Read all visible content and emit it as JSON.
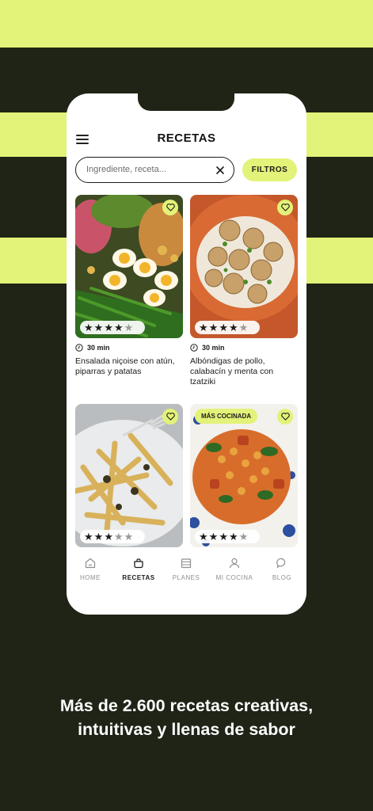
{
  "header": {
    "title": "RECETAS"
  },
  "search": {
    "placeholder": "Ingrediente, receta..."
  },
  "filter": {
    "label": "FILTROS"
  },
  "icons": {
    "menu": "hamburger-menu-icon",
    "clear": "close-icon",
    "favorite": "heart-icon",
    "time": "clock-icon"
  },
  "colors": {
    "accent": "#e3f278",
    "background": "#1f2416",
    "text": "#1b1b1b"
  },
  "recipes": [
    {
      "title": "Ensalada niçoise con atún, piparras y patatas",
      "time": "30 min",
      "rating": 4
    },
    {
      "title": "Albóndigas de pollo, calabacín y menta con tzatziki",
      "time": "30 min",
      "rating": 4
    },
    {
      "rating": 3
    },
    {
      "badge": "MÁS COCINADA",
      "rating": 4
    }
  ],
  "tabs": [
    {
      "label": "HOME",
      "icon": "home-icon",
      "active": false
    },
    {
      "label": "RECETAS",
      "icon": "pot-icon",
      "active": true
    },
    {
      "label": "PLANES",
      "icon": "planner-icon",
      "active": false
    },
    {
      "label": "MI COCINA",
      "icon": "user-icon",
      "active": false
    },
    {
      "label": "BLOG",
      "icon": "chat-icon",
      "active": false
    }
  ],
  "tagline": {
    "line1": "Más de 2.600 recetas creativas,",
    "line2": "intuitivas y llenas de sabor"
  }
}
